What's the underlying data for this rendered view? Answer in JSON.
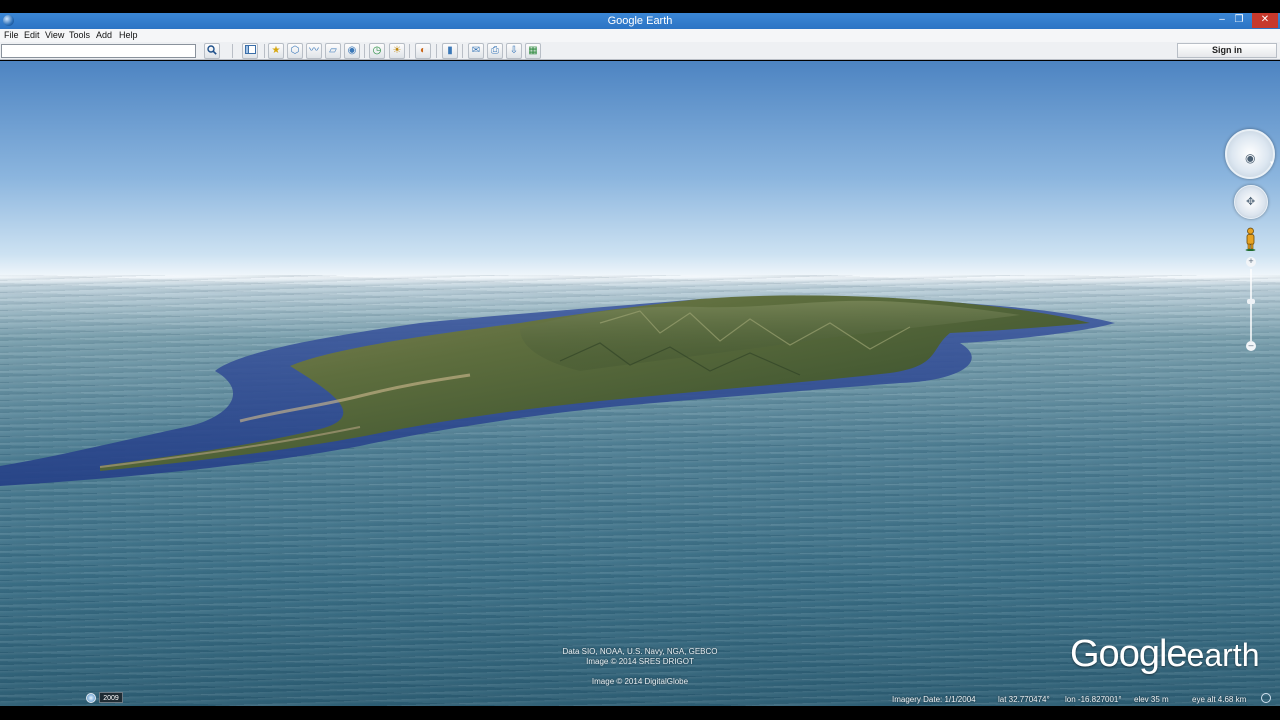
{
  "window": {
    "title": "Google Earth",
    "minimize_glyph": "–",
    "maximize_glyph": "❐",
    "close_glyph": "✕"
  },
  "menu": {
    "file": "File",
    "edit": "Edit",
    "view": "View",
    "tools": "Tools",
    "add": "Add",
    "help": "Help"
  },
  "toolbar": {
    "search_value": "",
    "sign_in": "Sign in",
    "icons": {
      "search": "search-icon",
      "sidebar": "sidebar-toggle-icon",
      "placemark": "add-placemark-icon",
      "polygon": "add-polygon-icon",
      "path": "add-path-icon",
      "overlay": "image-overlay-icon",
      "tour": "record-tour-icon",
      "historical": "historical-imagery-icon",
      "sun": "sunlight-icon",
      "planet": "planet-switch-icon",
      "ruler": "ruler-icon",
      "email": "email-icon",
      "print": "print-icon",
      "save_image": "save-image-icon",
      "maps": "view-in-maps-icon"
    }
  },
  "viewport": {
    "attribution_line1": "Data SIO, NOAA, U.S. Navy, NGA, GEBCO",
    "attribution_line2": "Image © 2014 SRES DRIGOT",
    "attribution_line3": "Image © 2014 DigitalGlobe",
    "logo_google": "Google",
    "logo_earth": "earth",
    "colors": {
      "sky_top": "#4d84c2",
      "sea": "#3b6f86",
      "island": "#5a6b3c"
    }
  },
  "status": {
    "year": "2009",
    "imagery_date": "Imagery Date: 1/1/2004",
    "lat": "lat  32.770474°",
    "lon": "lon  -16.827001°",
    "elev": "elev   35 m",
    "eye_alt": "eye alt   4.68 km"
  },
  "nav": {
    "look_icon": "look-around-icon",
    "move_icon": "move-joystick-icon",
    "pegman_icon": "street-view-pegman-icon",
    "zoom_in_label": "+",
    "zoom_out_label": "–",
    "zoom_level": 0.45
  }
}
